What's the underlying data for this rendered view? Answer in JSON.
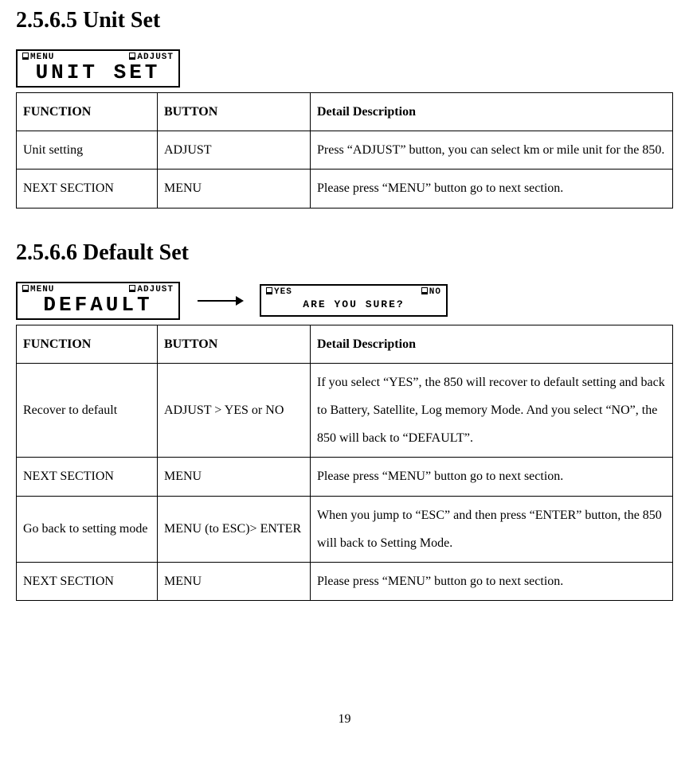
{
  "section1": {
    "heading": "2.5.6.5 Unit Set",
    "lcd": {
      "topLeft": "MENU",
      "topRight": "ADJUST",
      "main": "UNIT SET"
    },
    "headers": {
      "c1": "FUNCTION",
      "c2": "BUTTON",
      "c3": "Detail Description"
    },
    "rows": [
      {
        "c1": "Unit setting",
        "c2": "ADJUST",
        "c3": "Press “ADJUST” button, you can select km or mile unit for the 850."
      },
      {
        "c1": "NEXT SECTION",
        "c2": "MENU",
        "c3": "Please press “MENU” button go to next section."
      }
    ]
  },
  "section2": {
    "heading": "2.5.6.6 Default Set",
    "lcd1": {
      "topLeft": "MENU",
      "topRight": "ADJUST",
      "main": "DEFAULT"
    },
    "lcd2": {
      "topLeft": "YES",
      "topRight": "NO",
      "main": "ARE YOU SURE?"
    },
    "headers": {
      "c1": "FUNCTION",
      "c2": "BUTTON",
      "c3": "Detail Description"
    },
    "rows": [
      {
        "c1": "Recover to default",
        "c2": "ADJUST > YES or NO",
        "c3": "If you select “YES”, the 850 will recover to default setting and back to Battery, Satellite, Log memory Mode. And you select “NO”, the 850 will back to “DEFAULT”."
      },
      {
        "c1": "NEXT SECTION",
        "c2": "MENU",
        "c3": "Please press “MENU” button go to next section."
      },
      {
        "c1": "Go back to setting mode",
        "c2": "MENU (to ESC)> ENTER",
        "c3": "When you jump to “ESC” and then press “ENTER” button, the 850 will back to Setting Mode."
      },
      {
        "c1": "NEXT SECTION",
        "c2": "MENU",
        "c3": "Please press “MENU” button go to next section."
      }
    ]
  },
  "pageNumber": "19"
}
